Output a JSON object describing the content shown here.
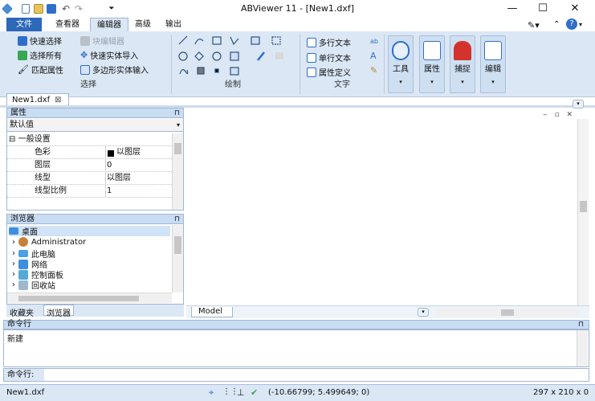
{
  "window": {
    "title": "ABViewer 11 - [New1.dxf]",
    "minimize": "—",
    "maximize": "☐",
    "close": "✕"
  },
  "quick_access": {
    "icons": [
      "app-icon",
      "new-file-icon",
      "open-folder-icon",
      "save-icon",
      "undo-icon",
      "redo-icon",
      "customize-icon"
    ]
  },
  "menu": {
    "tabs": [
      {
        "label": "文件"
      },
      {
        "label": "查看器"
      },
      {
        "label": "编辑器"
      },
      {
        "label": "高级"
      },
      {
        "label": "输出"
      }
    ],
    "right_icons": [
      "style-icon",
      "minimize-ribbon-icon",
      "help-icon"
    ],
    "help": "?"
  },
  "ribbon": {
    "select": {
      "label": "选择",
      "quick_select": "快速选择",
      "select_all": "选择所有",
      "match_props": "匹配属性",
      "block_editor": "块编辑器",
      "fast_import": "快速实体导入",
      "poly_input": "多边形实体输入"
    },
    "draw": {
      "label": "绘制"
    },
    "text": {
      "label": "文字",
      "mtext": "多行文本",
      "stext": "单行文本",
      "attdef": "属性定义"
    },
    "big": {
      "tools": "工具",
      "properties": "属性",
      "snap": "捕捉",
      "edit": "编辑"
    },
    "colors": {
      "blue": "#2f6fc9",
      "green": "#3aa655",
      "red": "#d4322c",
      "orange": "#e89a2c"
    }
  },
  "document": {
    "tab": "New1.dxf",
    "close": "⊠"
  },
  "properties_panel": {
    "title": "属性",
    "pin": "⊓",
    "dropdown": "默认值",
    "section": "一般设置",
    "rows": [
      {
        "name": "色彩",
        "value": "以图层"
      },
      {
        "name": "图层",
        "value": "0"
      },
      {
        "name": "线型",
        "value": "以图层"
      },
      {
        "name": "线型比例",
        "value": "1"
      }
    ]
  },
  "browser_panel": {
    "title": "浏览器",
    "pin": "⊓",
    "items": [
      "桌面",
      "Administrator",
      "此电脑",
      "网络",
      "控制面板",
      "回收站"
    ],
    "tabs": [
      "收藏夹",
      "浏览器"
    ]
  },
  "canvas": {
    "model_tab": "Model"
  },
  "command": {
    "title": "命令行",
    "history": "新建",
    "prompt": "命令行:"
  },
  "status": {
    "file": "New1.dxf",
    "coords": "(-10.66799; 5.499649; 0)",
    "size": "297 x 210 x 0"
  }
}
